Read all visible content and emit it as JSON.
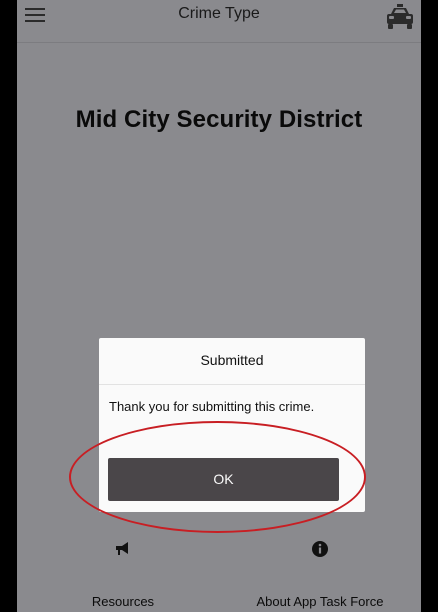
{
  "header": {
    "title": "Crime Type",
    "menu_icon": "hamburger-menu-icon",
    "right_icon": "police-car-icon"
  },
  "main": {
    "heading": "Mid City Security District"
  },
  "dialog": {
    "title": "Submitted",
    "message": "Thank you for submitting this crime.",
    "ok_label": "OK"
  },
  "bottom_nav": {
    "items": [
      {
        "label": "Resources",
        "icon": "megaphone-icon"
      },
      {
        "label": "About App Task Force",
        "icon": "info-icon"
      }
    ]
  },
  "colors": {
    "overlay_background": "#8a8a8e",
    "dialog_background": "#fafafa",
    "ok_button": "#4a4649",
    "annotation_ring": "#c81e23"
  }
}
